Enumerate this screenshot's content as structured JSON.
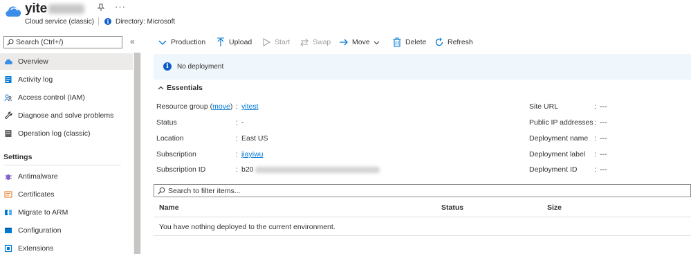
{
  "header": {
    "title_prefix": "yite",
    "pin_icon": "pin-icon",
    "more_label": "···",
    "subtitle": "Cloud service (classic)",
    "directory": "Directory: Microsoft"
  },
  "sidebar": {
    "search_placeholder": "Search (Ctrl+/)",
    "collapse_label": "«",
    "items": [
      {
        "label": "Overview",
        "icon": "cloud-icon"
      },
      {
        "label": "Activity log",
        "icon": "activity-log-icon"
      },
      {
        "label": "Access control (IAM)",
        "icon": "people-icon"
      },
      {
        "label": "Diagnose and solve problems",
        "icon": "wrench-icon"
      },
      {
        "label": "Operation log (classic)",
        "icon": "log-icon"
      }
    ],
    "settings_header": "Settings",
    "settings_items": [
      {
        "label": "Antimalware",
        "icon": "bug-icon"
      },
      {
        "label": "Certificates",
        "icon": "certificate-icon"
      },
      {
        "label": "Migrate to ARM",
        "icon": "migrate-icon"
      },
      {
        "label": "Configuration",
        "icon": "configuration-icon"
      },
      {
        "label": "Extensions",
        "icon": "extensions-icon"
      }
    ]
  },
  "toolbar": {
    "production": "Production",
    "upload": "Upload",
    "start": "Start",
    "swap": "Swap",
    "move": "Move",
    "delete": "Delete",
    "refresh": "Refresh"
  },
  "banner": {
    "text": "No deployment"
  },
  "essentials": {
    "header": "Essentials",
    "left": {
      "resource_group_label": "Resource group",
      "resource_group_move": "move",
      "resource_group_value": "yitest",
      "status_label": "Status",
      "status_value": "-",
      "location_label": "Location",
      "location_value": "East US",
      "subscription_label": "Subscription",
      "subscription_value": "jiayiwu",
      "subscription_id_label": "Subscription ID",
      "subscription_id_prefix": "b20"
    },
    "right": {
      "site_url_label": "Site URL",
      "site_url_value": "---",
      "public_ip_label": "Public IP addresses",
      "public_ip_value": "---",
      "deployment_name_label": "Deployment name",
      "deployment_name_value": "---",
      "deployment_label_label": "Deployment label",
      "deployment_label_value": "---",
      "deployment_id_label": "Deployment ID",
      "deployment_id_value": "---"
    }
  },
  "filter": {
    "placeholder": "Search to filter items..."
  },
  "table": {
    "columns": [
      "Name",
      "Status",
      "Size"
    ],
    "empty_message": "You have nothing deployed to the current environment."
  },
  "colors": {
    "accent": "#0078d4",
    "banner_bg": "#eff6fc",
    "info_blue": "#0f5ec7",
    "selected_bg": "#edebe9"
  }
}
